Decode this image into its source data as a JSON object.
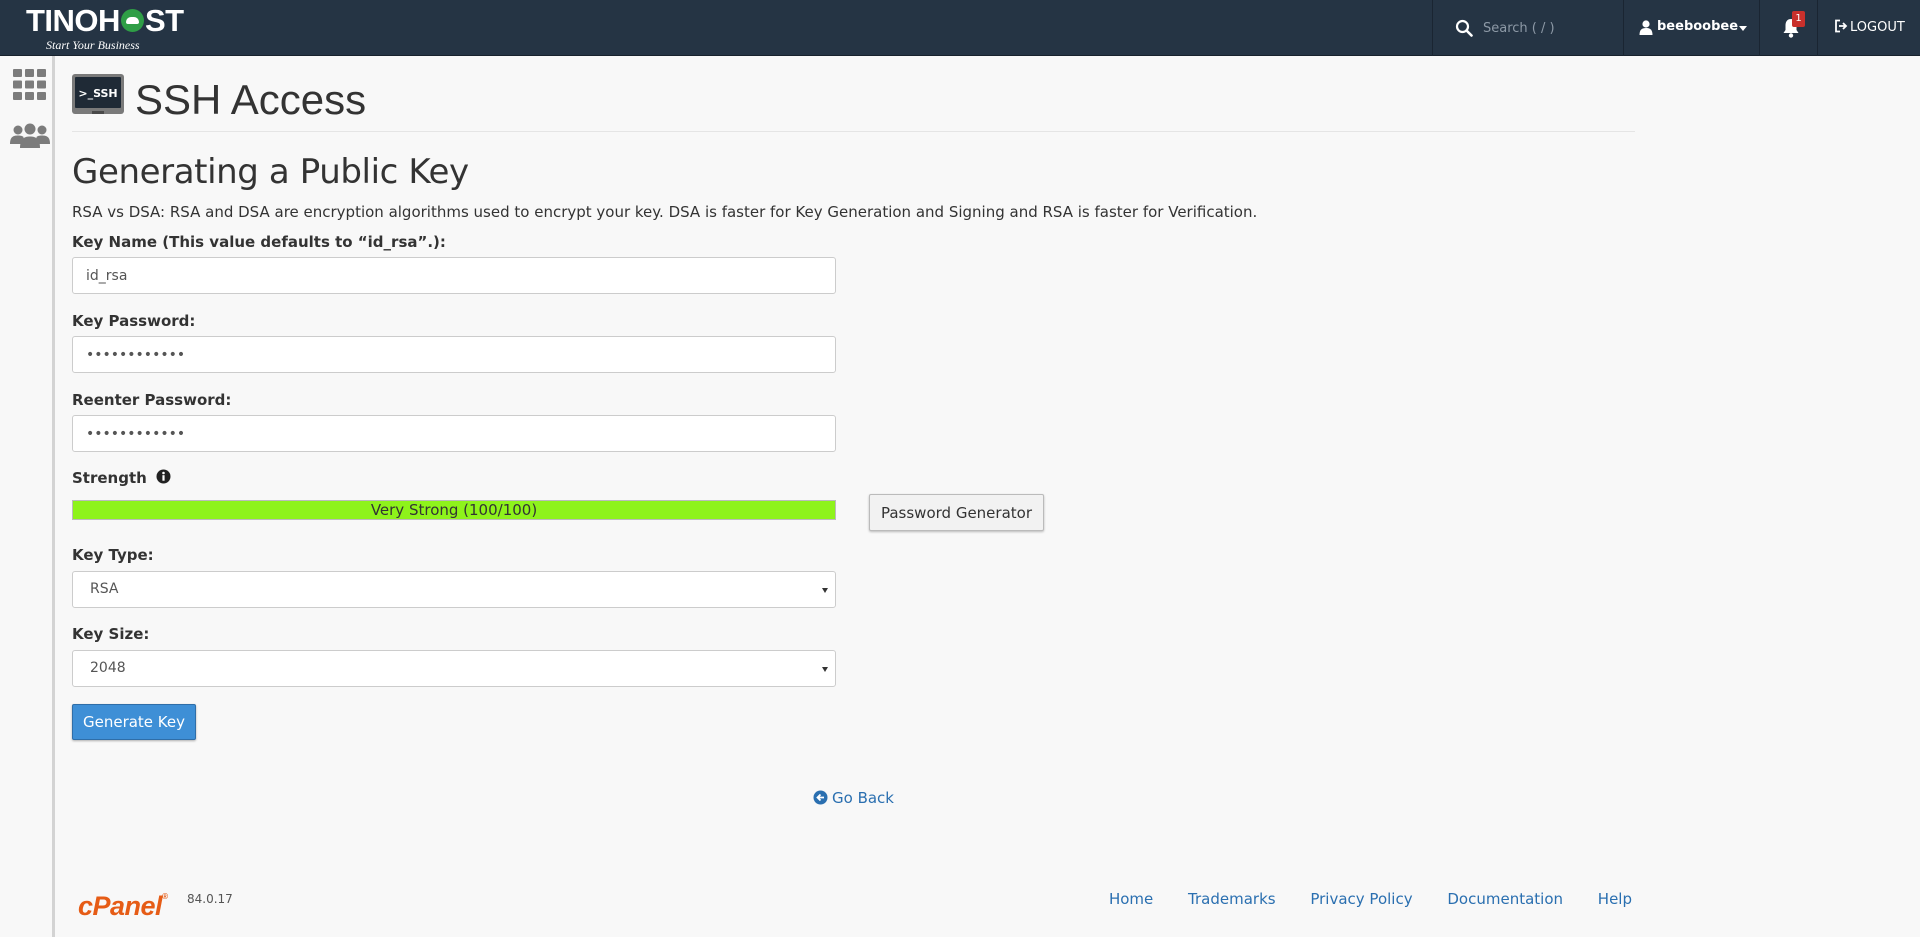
{
  "brand": {
    "name_left": "TINOH",
    "name_right": "ST",
    "tagline": "Start Your Business"
  },
  "topbar": {
    "search": {
      "placeholder": "Search ( / )"
    },
    "user": {
      "name": "beeboobee"
    },
    "notifications": {
      "count": "1"
    },
    "logout_label": "LOGOUT"
  },
  "sidebar": {
    "items": [
      {
        "icon": "apps-grid-icon"
      },
      {
        "icon": "users-group-icon"
      }
    ]
  },
  "page": {
    "icon_label": ">_SSH",
    "title": "SSH Access",
    "section_title": "Generating a Public Key",
    "intro": "RSA vs DSA: RSA and DSA are encryption algorithms used to encrypt your key. DSA is faster for Key Generation and Signing and RSA is faster for Verification."
  },
  "form": {
    "key_name": {
      "label": "Key Name (This value defaults to “id_rsa”.):",
      "value": "id_rsa"
    },
    "key_password": {
      "label": "Key Password:",
      "value": "••••••••••••"
    },
    "reenter_password": {
      "label": "Reenter Password:",
      "value": "••••••••••••"
    },
    "strength": {
      "label": "Strength",
      "text": "Very Strong (100/100)",
      "score": 100,
      "fill_color": "#8ef31b"
    },
    "password_generator_label": "Password Generator",
    "key_type": {
      "label": "Key Type:",
      "selected": "RSA"
    },
    "key_size": {
      "label": "Key Size:",
      "selected": "2048"
    },
    "generate_label": "Generate Key"
  },
  "go_back_label": "Go Back",
  "footer": {
    "logo": "cPanel",
    "logo_mark": "®",
    "version": "84.0.17",
    "links": [
      "Home",
      "Trademarks",
      "Privacy Policy",
      "Documentation",
      "Help"
    ]
  },
  "colors": {
    "topbar": "#253444",
    "primary": "#3e8fd6",
    "link": "#2a6fb0",
    "cpanel_orange": "#e65c16"
  }
}
